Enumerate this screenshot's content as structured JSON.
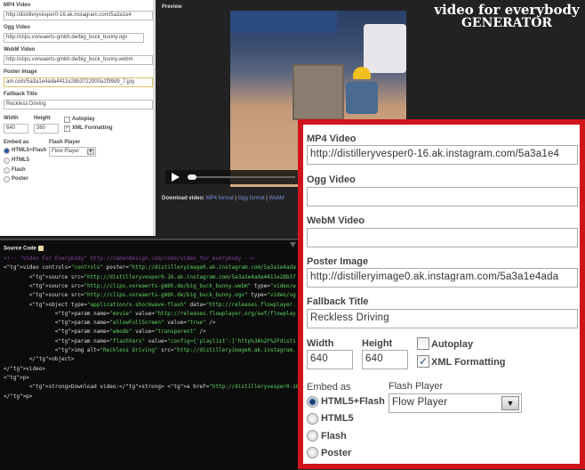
{
  "left_form": {
    "mp4_label": "MP4 Video",
    "mp4_value": "http://distilleryvesper0-16.ak.instagram.com/5a3a1e4",
    "ogg_label": "Ogg Video",
    "ogg_value": "http://clips.vorwaerts-gmbh.de/big_buck_bunny.ogv",
    "webm_label": "WebM Video",
    "webm_value": "http://clips.vorwaerts-gmbh.de/big_buck_bunny.webm",
    "poster_label": "Poster Image",
    "poster_value": "am.com/5a3a1e4ada4411e28b3722000a1f99d9_7.jpg",
    "fallback_label": "Fallback Title",
    "fallback_value": "Reckless Driving",
    "width_label": "Width",
    "width_value": "640",
    "height_label": "Height",
    "height_value": "360",
    "autoplay_label": "Autoplay",
    "xml_label": "XML Formatting",
    "embed_label": "Embed as",
    "embed_options": [
      "HTML5+Flash",
      "HTML5",
      "Flash",
      "Poster"
    ],
    "flash_label": "Flash Player",
    "flash_value": "Flow Player"
  },
  "preview": {
    "title": "Preview",
    "logo_line1": "video for everybody",
    "logo_line2": "GENERATOR",
    "download_label": "Download video:",
    "links": [
      "MP4 format",
      "Ogg format",
      "WebM"
    ],
    "separator": "|"
  },
  "source": {
    "title": "Source Code",
    "lines": [
      "<!-- \"Video For Everybody\" http://camendesign.com/code/video_for_everybody -->",
      "<video controls=\"controls\" poster=\"http://distilleryimage0.ak.instagram.com/5a3a1e4ada",
      "        <source src=\"http://distilleryvesper0-16.ak.instagram.com/5a3a1e4ada4411e28b37",
      "        <source src=\"http://clips.vorwaerts-gmbh.de/big_buck_bunny.webm\" type=\"video/w",
      "        <source src=\"http://clips.vorwaerts-gmbh.de/big_buck_bunny.ogv\" type=\"video/og",
      "        <object type=\"application/x-shockwave-flash\" data=\"http://releases.flowplayer.",
      "                <param name=\"movie\" value=\"http://releases.flowplayer.org/swf/flowplay",
      "                <param name=\"allowFullScreen\" value=\"true\" />",
      "                <param name=\"wmode\" value=\"transparent\" />",
      "                <param name=\"flashVars\" value=\"config={'playlist':['http%3A%2F%2Fdisti",
      "                <img alt=\"Reckless Driving\" src=\"http://distilleryimage0.ak.instagram.",
      "        </object>",
      "</video>",
      "<p>",
      "        <strong>Download video:</strong> <a href=\"http://distilleryvesper0-16.ak.insta",
      "</p>"
    ]
  },
  "zoom_form": {
    "mp4_label": "MP4 Video",
    "mp4_value": "http://distilleryvesper0-16.ak.instagram.com/5a3a1e4",
    "ogg_label": "Ogg Video",
    "ogg_value": "",
    "webm_label": "WebM Video",
    "webm_value": "",
    "poster_label": "Poster Image",
    "poster_value": "http://distilleryimage0.ak.instagram.com/5a3a1e4ada",
    "fallback_label": "Fallback Title",
    "fallback_value": "Reckless Driving",
    "width_label": "Width",
    "width_value": "640",
    "height_label": "Height",
    "height_value": "640",
    "autoplay_label": "Autoplay",
    "xml_label": "XML Formatting",
    "embed_label": "Embed as",
    "embed_options": [
      "HTML5+Flash",
      "HTML5",
      "Flash",
      "Poster"
    ],
    "flash_label": "Flash Player",
    "flash_value": "Flow Player"
  },
  "colors": {
    "highlight": "#d0141c",
    "link": "#7f8fe0"
  }
}
